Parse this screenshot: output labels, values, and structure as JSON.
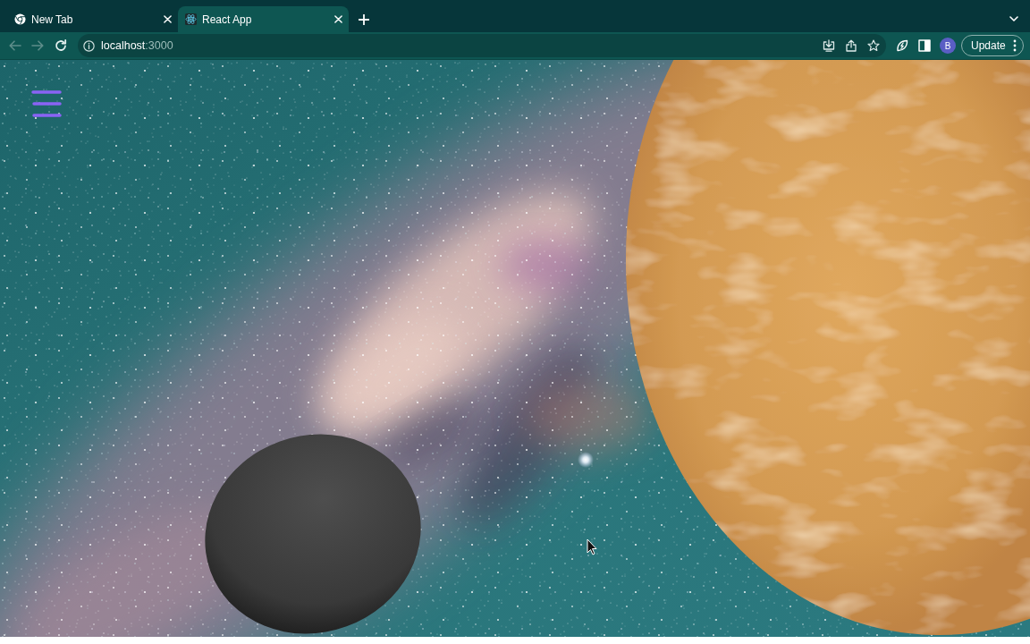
{
  "tabs": [
    {
      "title": "New Tab",
      "kind": "browser",
      "selected": false
    },
    {
      "title": "React App",
      "kind": "atom",
      "selected": true
    }
  ],
  "toolbar": {
    "nav": [
      {
        "kind": "back",
        "disabled": true
      },
      {
        "kind": "forward",
        "disabled": true
      },
      {
        "kind": "reload",
        "disabled": false
      }
    ],
    "address": {
      "host": "localhost",
      "port": ":3000"
    },
    "profile": {
      "initial": "B"
    },
    "update_button": {
      "label": "Update"
    }
  }
}
